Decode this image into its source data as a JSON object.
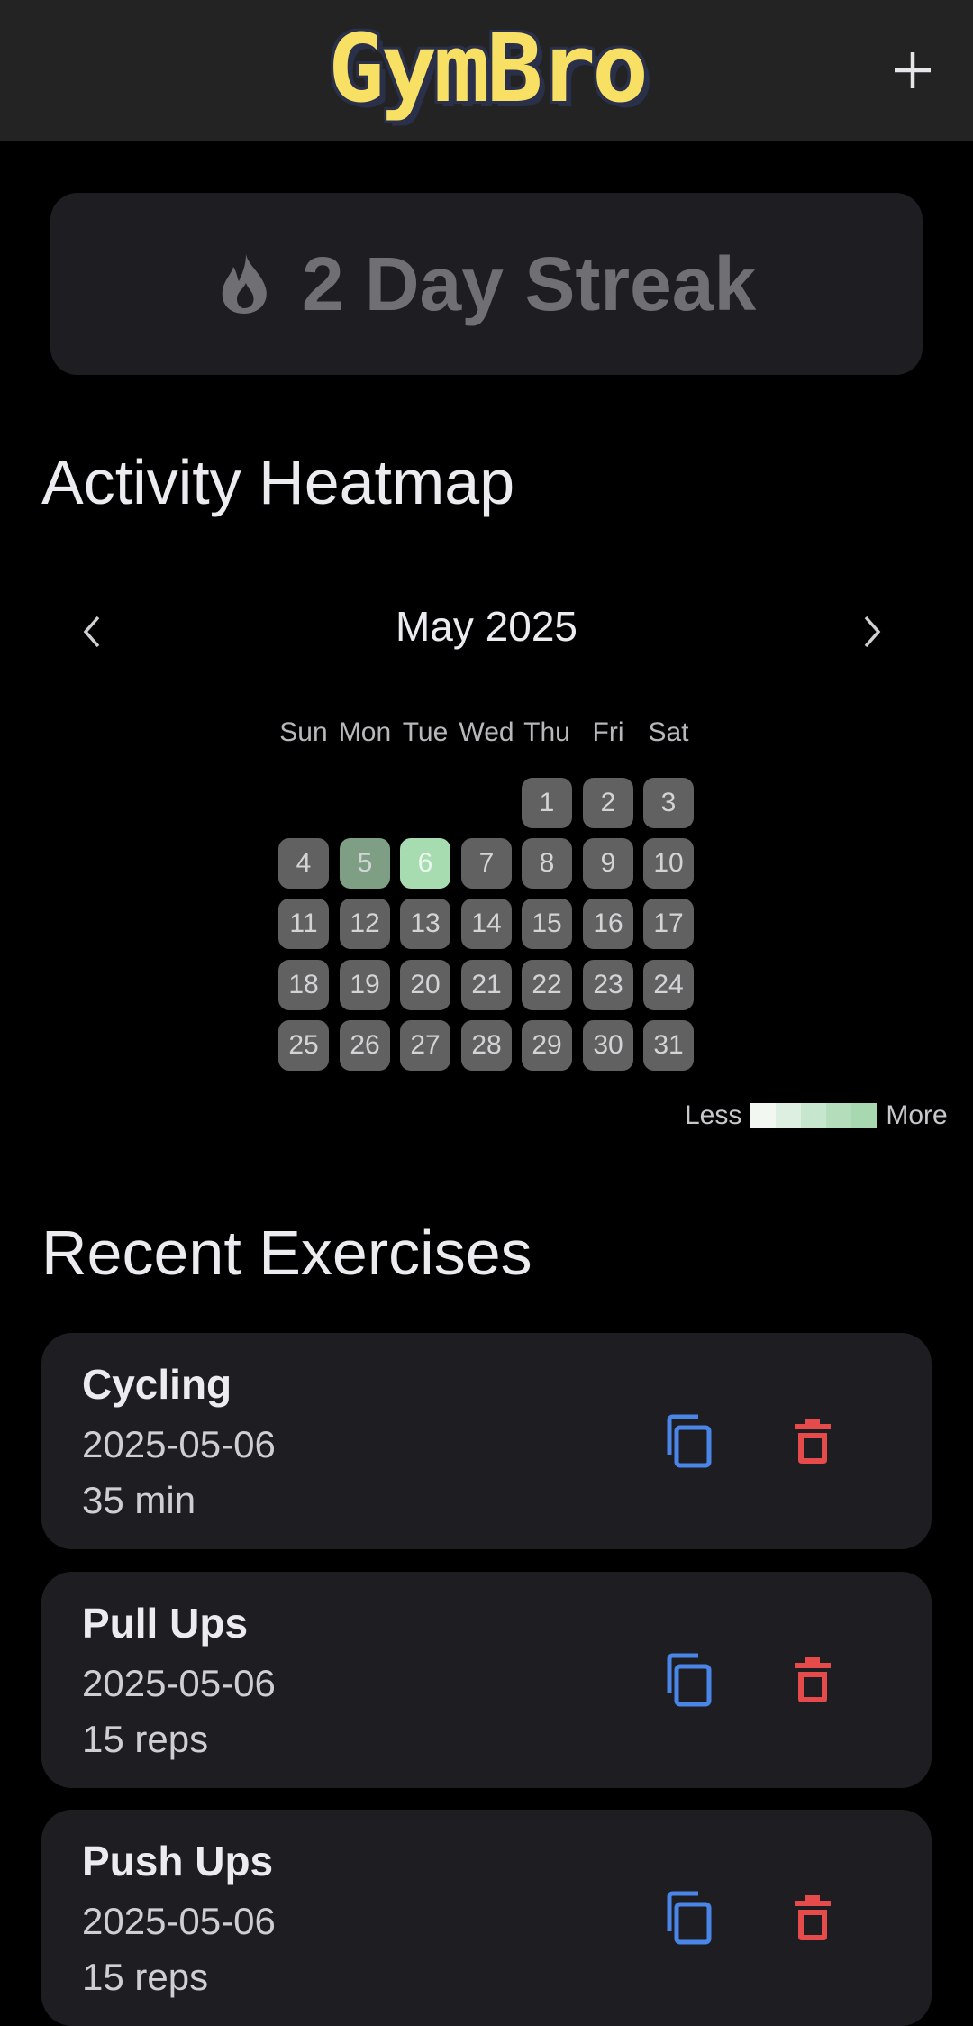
{
  "header": {
    "app_name": "GymBro",
    "add_label": "+",
    "add_icon": "plus-icon"
  },
  "streak": {
    "icon": "flame-icon",
    "text": "2 Day Streak"
  },
  "heatmap": {
    "title": "Activity Heatmap",
    "month": "May 2025",
    "prev_icon": "chevron-left-icon",
    "next_icon": "chevron-right-icon",
    "weekdays": [
      "Sun",
      "Mon",
      "Tue",
      "Wed",
      "Thu",
      "Fri",
      "Sat"
    ],
    "first_weekday_index": 4,
    "days": [
      "1",
      "2",
      "3",
      "4",
      "5",
      "6",
      "7",
      "8",
      "9",
      "10",
      "11",
      "12",
      "13",
      "14",
      "15",
      "16",
      "17",
      "18",
      "19",
      "20",
      "21",
      "22",
      "23",
      "24",
      "25",
      "26",
      "27",
      "28",
      "29",
      "30",
      "31"
    ],
    "activity_levels": {
      "5": 1,
      "6": 2
    },
    "legend_less": "Less",
    "legend_more": "More",
    "legend_colors": [
      "#f2f7f2",
      "#dcefe0",
      "#c6e7cd",
      "#b3ddbb",
      "#a7d8b0"
    ]
  },
  "recent": {
    "title": "Recent Exercises",
    "items": [
      {
        "name": "Cycling",
        "date": "2025-05-06",
        "detail": "35 min"
      },
      {
        "name": "Pull Ups",
        "date": "2025-05-06",
        "detail": "15 reps"
      },
      {
        "name": "Push Ups",
        "date": "2025-05-06",
        "detail": "15 reps"
      }
    ],
    "copy_icon": "copy-icon",
    "delete_icon": "trash-icon"
  },
  "colors": {
    "accent_copy": "#4a86e8",
    "accent_delete": "#e54b4b",
    "logo_yellow": "#f7e064",
    "activity_low": "#7f9f85",
    "activity_high": "#a7dcb0",
    "day_empty": "#616161"
  }
}
